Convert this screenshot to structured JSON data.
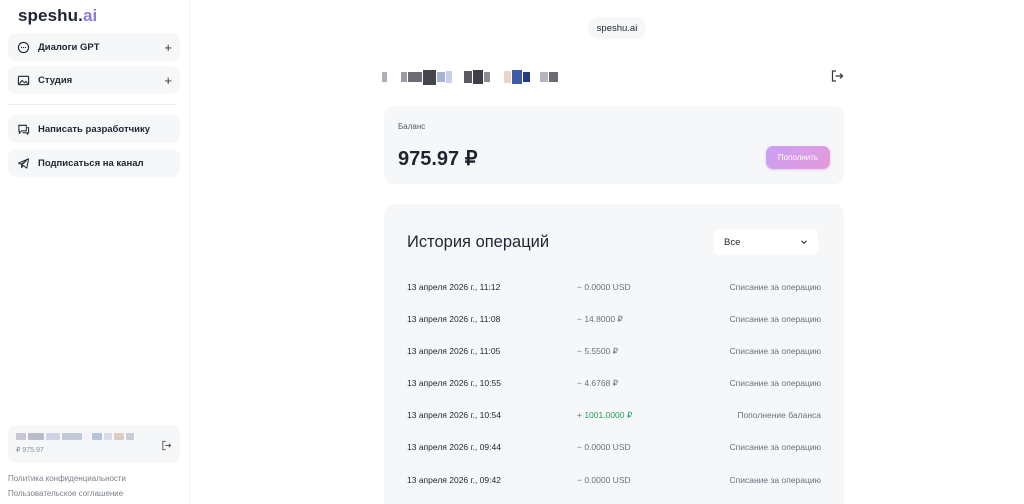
{
  "sidebar": {
    "logo_main": "speshu.",
    "logo_accent": "ai",
    "items": [
      {
        "label": "Диалоги GPT",
        "icon": "chat-bubble-icon",
        "action": "+"
      },
      {
        "label": "Студия",
        "icon": "image-icon",
        "action": "+"
      },
      {
        "label": "Написать разработчику",
        "icon": "message-icon"
      },
      {
        "label": "Подписаться на канал",
        "icon": "telegram-icon"
      }
    ],
    "user": {
      "balance": "₽ 975.97"
    },
    "footer": {
      "privacy": "Политика конфиденциальности",
      "terms": "Пользовательское соглашение"
    }
  },
  "main": {
    "brand": "speshu.ai",
    "balance": {
      "label": "Баланс",
      "value": "975.97 ₽",
      "topup_label": "Пополнить"
    },
    "history": {
      "title": "История операций",
      "filter": "Все",
      "rows": [
        {
          "date": "13 апреля 2026 г., 11:12",
          "amount": "− 0.0000 USD",
          "type": "debit",
          "desc": "Списание за операцию"
        },
        {
          "date": "13 апреля 2026 г., 11:08",
          "amount": "− 14.8000 ₽",
          "type": "debit",
          "desc": "Списание за операцию"
        },
        {
          "date": "13 апреля 2026 г., 11:05",
          "amount": "− 5.5500 ₽",
          "type": "debit",
          "desc": "Списание за операцию"
        },
        {
          "date": "13 апреля 2026 г., 10:55",
          "amount": "− 4.6768 ₽",
          "type": "debit",
          "desc": "Списание за операцию"
        },
        {
          "date": "13 апреля 2026 г., 10:54",
          "amount": "+ 1001.0000 ₽",
          "type": "credit",
          "desc": "Пополнение баланса"
        },
        {
          "date": "13 апреля 2026 г., 09:44",
          "amount": "− 0.0000 USD",
          "type": "debit",
          "desc": "Списание за операцию"
        },
        {
          "date": "13 апреля 2026 г., 09:42",
          "amount": "− 0.0000 USD",
          "type": "debit",
          "desc": "Списание за операцию"
        }
      ]
    }
  },
  "colors": {
    "accent": "#8a7dd8",
    "credit": "#2e9a5c",
    "button_from": "#c9a0f5",
    "button_to": "#e59ad9"
  }
}
